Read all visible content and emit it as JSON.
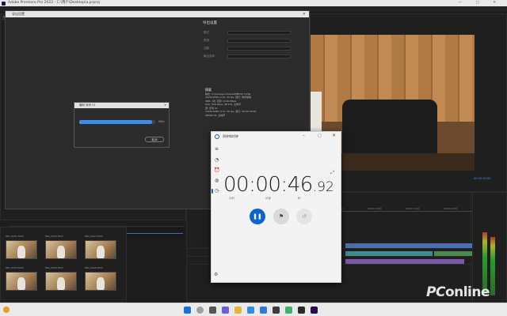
{
  "premiere": {
    "title": "Adobe Premiere Pro 2022 - C:\\用户\\Desktop\\a.prproj",
    "window_controls": "—  ▢  ✕"
  },
  "export_dialog": {
    "title": "导出设置",
    "section_title": "导出设置",
    "rows": [
      {
        "label": "格式"
      },
      {
        "label": "预设"
      },
      {
        "label": "注释"
      },
      {
        "label": "输出名称"
      }
    ],
    "summary_header": "摘要",
    "summary_lines": [
      "输出: C:\\Users\\pc\\Videos\\MPEG4 H.264",
      "1920x1080 (1.0), 30 fps, 逐行, 软件编码",
      "VBR, 1次, 目标 10.00 Mbps",
      "AAC, 320 kbps, 48 kHz, 立体声",
      "源: 序列 01",
      "1920x1080 (1.0), 30 fps, 逐行, 00:00:30:00",
      "48000 Hz, 立体声"
    ]
  },
  "render_dialog": {
    "title": "编码 序列 01",
    "progress": 0.96,
    "progress_label": "96%",
    "cancel_label": "取消"
  },
  "program_monitor": {
    "timecode": "00:00:30:00"
  },
  "timeline": {
    "ruler_labels": [
      "00:00:05:00",
      "00:00:10:00",
      "00:00:15:00",
      "00:00:20:00"
    ]
  },
  "bin": {
    "thumb_labels": [
      "IMG_0001.MOV",
      "IMG_0002.MOV",
      "IMG_0003.MOV",
      "IMG_0004.MOV",
      "IMG_0005.MOV",
      "IMG_0006.MOV"
    ]
  },
  "clock": {
    "app_title": "闹钟和时钟",
    "time_main": "00:00:46",
    "time_fraction": ".92",
    "units": {
      "hours": "小时",
      "minutes": "分钟",
      "seconds": "秒"
    },
    "pause_icon": "pause-icon",
    "lap_icon": "flag-icon",
    "reset_icon": "reset-icon",
    "accent_color": "#0a64d2"
  },
  "watermark": {
    "pc": "PC",
    "rest": "online"
  }
}
